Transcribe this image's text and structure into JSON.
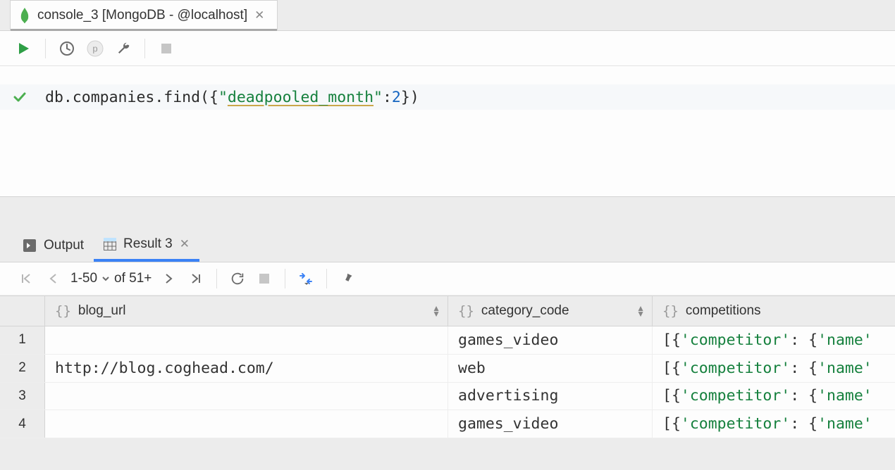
{
  "tab": {
    "title": "console_3 [MongoDB - @localhost]"
  },
  "editor": {
    "code": {
      "prefix": "db.companies.find({",
      "key_quoted": "\"",
      "key_underlined": "deadpooled_month",
      "key_close": "\"",
      "colon": ":",
      "num": "2",
      "suffix": "})"
    }
  },
  "panel": {
    "output_label": "Output",
    "result_label": "Result 3"
  },
  "pager": {
    "range": "1-50",
    "of": "of 51+"
  },
  "columns": {
    "c1": "blog_url",
    "c2": "category_code",
    "c3": "competitions"
  },
  "rows": [
    {
      "n": "1",
      "blog_url": "",
      "category": "games_video",
      "comp_open": "[{",
      "comp_k1": "'competitor'",
      "comp_mid": ": {",
      "comp_k2": "'name'"
    },
    {
      "n": "2",
      "blog_url": "http://blog.coghead.com/",
      "category": "web",
      "comp_open": "[{",
      "comp_k1": "'competitor'",
      "comp_mid": ": {",
      "comp_k2": "'name'"
    },
    {
      "n": "3",
      "blog_url": "",
      "category": "advertising",
      "comp_open": "[{",
      "comp_k1": "'competitor'",
      "comp_mid": ": {",
      "comp_k2": "'name'"
    },
    {
      "n": "4",
      "blog_url": "",
      "category": "games_video",
      "comp_open": "[{",
      "comp_k1": "'competitor'",
      "comp_mid": ": {",
      "comp_k2": "'name'"
    }
  ]
}
